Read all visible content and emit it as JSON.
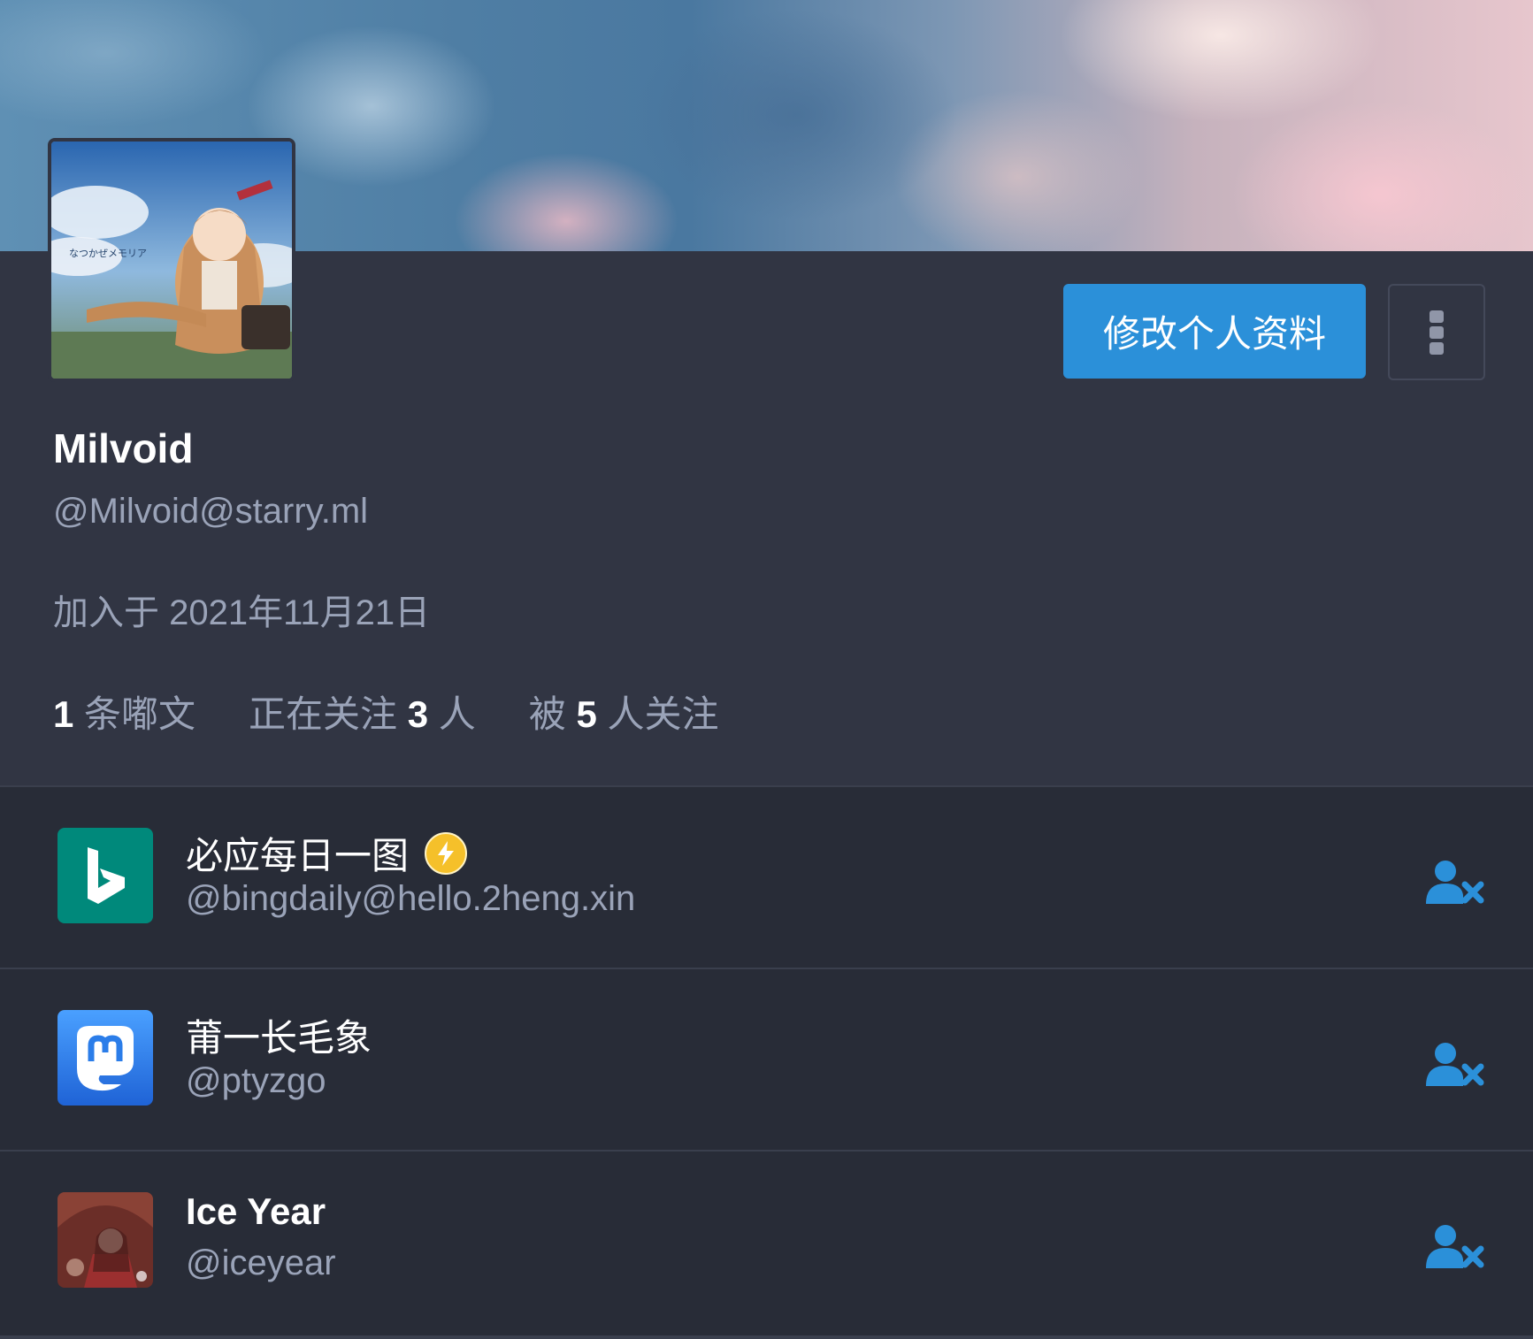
{
  "profile": {
    "display_name": "Milvoid",
    "acct": "@Milvoid@starry.ml",
    "joined": "加入于 2021年11月21日",
    "edit_label": "修改个人资料",
    "stats": {
      "posts_count": "1",
      "posts_label": "条嘟文",
      "following_prefix": "正在关注",
      "following_count": "3",
      "following_suffix": "人",
      "followers_prefix": "被",
      "followers_count": "5",
      "followers_suffix": "人关注"
    }
  },
  "following": [
    {
      "name": "必应每日一图",
      "acct": "@bingdaily@hello.2heng.xin",
      "bot": true,
      "avatar_icon": "bing-logo",
      "avatar_color": "#00897b"
    },
    {
      "name": "莆一长毛象",
      "acct": "@ptyzgo",
      "bot": false,
      "avatar_icon": "mastodon-logo",
      "avatar_color": "#2b90d9"
    },
    {
      "name": "Ice Year",
      "acct": "@iceyear",
      "bot": false,
      "avatar_icon": "anime-avatar",
      "avatar_color": "#7a3a30"
    }
  ],
  "colors": {
    "accent": "#2b90d9",
    "background": "#282c37",
    "card": "#313543",
    "muted_text": "#9aa3b8"
  }
}
